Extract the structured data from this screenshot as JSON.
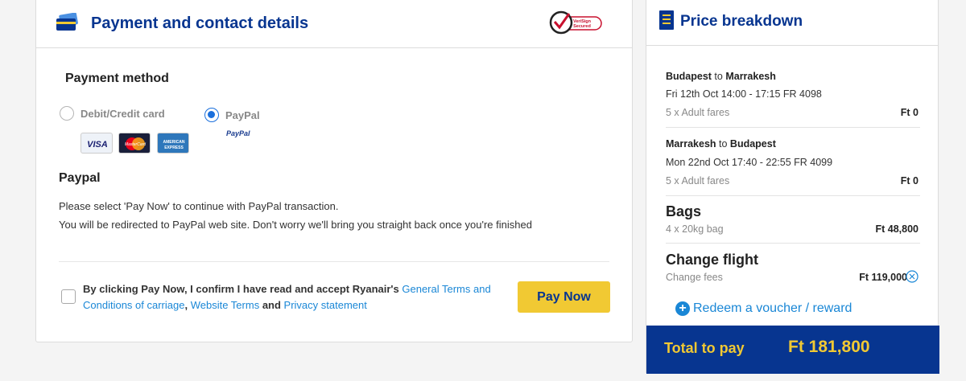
{
  "payment": {
    "title": "Payment and contact details",
    "secure_badge_text": "VeriSign Secured",
    "method_label": "Payment method",
    "options": [
      {
        "label": "Debit/Credit card",
        "selected": false
      },
      {
        "label": "PayPal",
        "selected": true
      }
    ],
    "card_logos": [
      "VISA",
      "MasterCard",
      "AMERICAN EXPRESS"
    ],
    "paypal_logo": "PayPal",
    "paypal_heading": "Paypal",
    "paypal_line1": "Please select 'Pay Now' to continue with PayPal transaction.",
    "paypal_line2": "You will be redirected to PayPal web site. Don't worry we'll bring you straight back once you're finished",
    "terms": {
      "prefix": "By clicking Pay Now, I confirm I have read and accept Ryanair's ",
      "link1": "General Terms and Conditions of carriage",
      "sep1": ", ",
      "link2": "Website Terms",
      "sep2": " and ",
      "link3": "Privacy statement"
    },
    "pay_button": "Pay Now"
  },
  "price": {
    "title": "Price breakdown",
    "outbound": {
      "from": "Budapest",
      "to_word": " to ",
      "to": "Marrakesh",
      "details": "Fri 12th Oct 14:00 - 17:15 FR 4098",
      "fare_label": "5 x Adult fares",
      "fare_value": "Ft 0"
    },
    "inbound": {
      "from": "Marrakesh",
      "to_word": " to ",
      "to": "Budapest",
      "details": "Mon 22nd Oct 17:40 - 22:55 FR 4099",
      "fare_label": "5 x Adult fares",
      "fare_value": "Ft 0"
    },
    "bags": {
      "label": "Bags",
      "detail": "4 x 20kg bag",
      "value": "Ft 48,800"
    },
    "change": {
      "label": "Change flight",
      "detail": "Change fees",
      "value": "Ft 119,000"
    },
    "voucher": "Redeem a voucher / reward",
    "total_label": "Total to pay",
    "total_value": "Ft 181,800"
  },
  "colors": {
    "brand_blue": "#073590",
    "accent_yellow": "#f1c933",
    "link_blue": "#1a87d6"
  }
}
